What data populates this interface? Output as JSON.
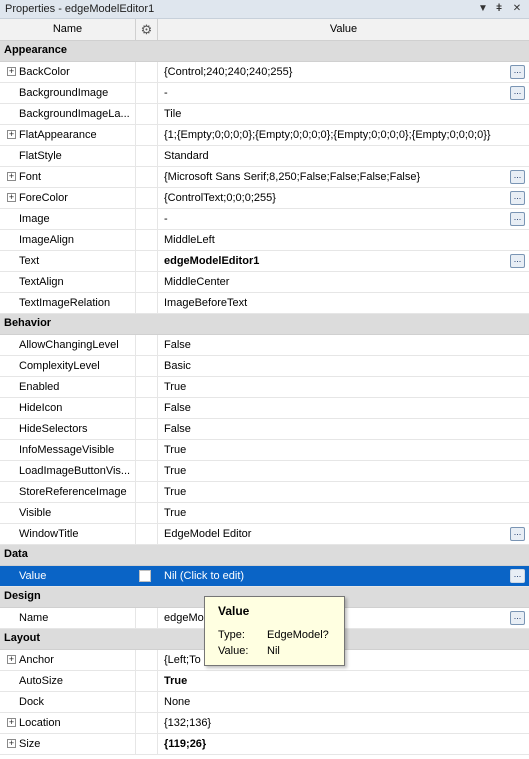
{
  "window": {
    "title": "Properties - edgeModelEditor1",
    "dropdown_icon": "▼",
    "pin_icon": "ǂ",
    "close_icon": "✕"
  },
  "header": {
    "name": "Name",
    "gear_icon": "⚙",
    "value": "Value"
  },
  "categories": [
    {
      "name": "Appearance",
      "props": [
        {
          "name": "BackColor",
          "value": "{Control;240;240;240;255}",
          "expandable": true,
          "ellipsis": true
        },
        {
          "name": "BackgroundImage",
          "value": "-",
          "ellipsis": true
        },
        {
          "name": "BackgroundImageLa...",
          "value": "Tile"
        },
        {
          "name": "FlatAppearance",
          "value": "{1;{Empty;0;0;0;0};{Empty;0;0;0;0};{Empty;0;0;0;0};{Empty;0;0;0;0}}",
          "expandable": true
        },
        {
          "name": "FlatStyle",
          "value": "Standard"
        },
        {
          "name": "Font",
          "value": "{Microsoft Sans Serif;8,250;False;False;False;False}",
          "expandable": true,
          "ellipsis": true
        },
        {
          "name": "ForeColor",
          "value": "{ControlText;0;0;0;255}",
          "expandable": true,
          "ellipsis": true
        },
        {
          "name": "Image",
          "value": "-",
          "ellipsis": true
        },
        {
          "name": "ImageAlign",
          "value": "MiddleLeft"
        },
        {
          "name": "Text",
          "value": "edgeModelEditor1",
          "bold": true,
          "ellipsis": true
        },
        {
          "name": "TextAlign",
          "value": "MiddleCenter"
        },
        {
          "name": "TextImageRelation",
          "value": "ImageBeforeText"
        }
      ]
    },
    {
      "name": "Behavior",
      "props": [
        {
          "name": "AllowChangingLevel",
          "value": "False"
        },
        {
          "name": "ComplexityLevel",
          "value": "Basic"
        },
        {
          "name": "Enabled",
          "value": "True"
        },
        {
          "name": "HideIcon",
          "value": "False"
        },
        {
          "name": "HideSelectors",
          "value": "False"
        },
        {
          "name": "InfoMessageVisible",
          "value": "True"
        },
        {
          "name": "LoadImageButtonVis...",
          "value": "True"
        },
        {
          "name": "StoreReferenceImage",
          "value": "True"
        },
        {
          "name": "Visible",
          "value": "True"
        },
        {
          "name": "WindowTitle",
          "value": "EdgeModel Editor",
          "ellipsis": true
        }
      ]
    },
    {
      "name": "Data",
      "props": [
        {
          "name": "Value",
          "value": "Nil (Click to edit)",
          "selected": true,
          "checkbox": true,
          "ellipsis": true
        }
      ]
    },
    {
      "name": "Design",
      "props": [
        {
          "name": "Name",
          "value": "edgeMod",
          "ellipsis": true
        }
      ]
    },
    {
      "name": "Layout",
      "props": [
        {
          "name": "Anchor",
          "value": "{Left;To",
          "expandable": true
        },
        {
          "name": "AutoSize",
          "value": "True",
          "bold": true
        },
        {
          "name": "Dock",
          "value": "None"
        },
        {
          "name": "Location",
          "value": "{132;136}",
          "expandable": true
        },
        {
          "name": "Size",
          "value": "{119;26}",
          "expandable": true,
          "bold": true
        }
      ]
    }
  ],
  "tooltip": {
    "title": "Value",
    "type_label": "Type:",
    "type_value": "EdgeModel?",
    "value_label": "Value:",
    "value_value": "Nil"
  },
  "symbols": {
    "expand": "+",
    "ellipsis": "..."
  }
}
